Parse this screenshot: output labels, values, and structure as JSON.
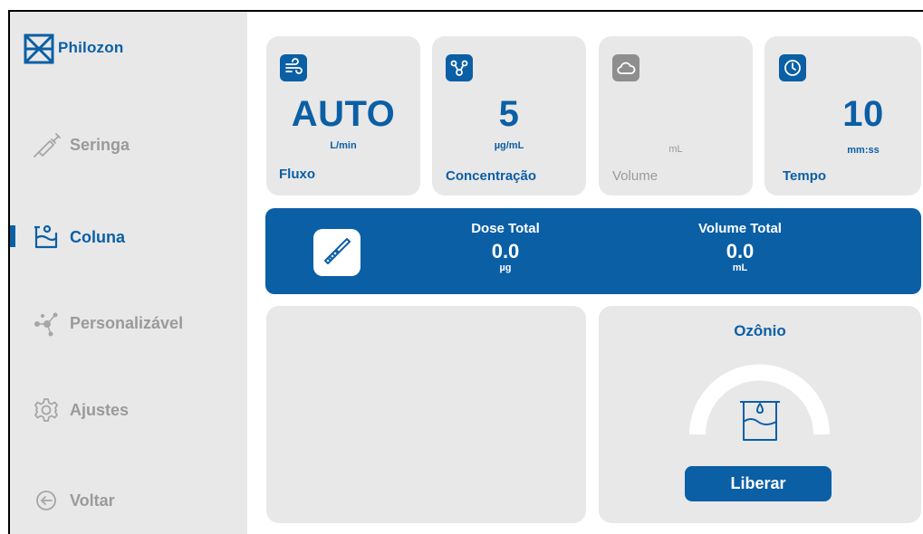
{
  "brand": {
    "name": "Philozon"
  },
  "sidebar": {
    "items": [
      {
        "label": "Seringa",
        "icon": "syringe-icon",
        "active": false
      },
      {
        "label": "Coluna",
        "icon": "column-beaker-icon",
        "active": true
      },
      {
        "label": "Personalizável",
        "icon": "molecule-icon",
        "active": false
      },
      {
        "label": "Ajustes",
        "icon": "gear-icon",
        "active": false
      },
      {
        "label": "Voltar",
        "icon": "back-arrow-icon",
        "active": false
      }
    ]
  },
  "stats": {
    "fluxo": {
      "value": "AUTO",
      "unit": "L/min",
      "label": "Fluxo",
      "icon": "wind-icon"
    },
    "concentracao": {
      "value": "5",
      "unit": "µg/mL",
      "label": "Concentração",
      "icon": "molecule-icon"
    },
    "volume": {
      "value": "",
      "unit": "mL",
      "label": "Volume",
      "icon": "cloud-icon"
    },
    "tempo": {
      "value": "10",
      "unit": "mm:ss",
      "label": "Tempo",
      "icon": "clock-icon"
    }
  },
  "dose": {
    "icon": "brush-icon",
    "dose_total": {
      "title": "Dose Total",
      "value": "0.0",
      "unit": "µg"
    },
    "volume_total": {
      "title": "Volume Total",
      "value": "0.0",
      "unit": "mL"
    }
  },
  "ozonio": {
    "title": "Ozônio",
    "button_label": "Liberar",
    "gauge_icon": "beaker-icon"
  },
  "colors": {
    "accent": "#0b5fa5",
    "panel": "#e8e8e8",
    "muted": "#9a9a9a"
  }
}
